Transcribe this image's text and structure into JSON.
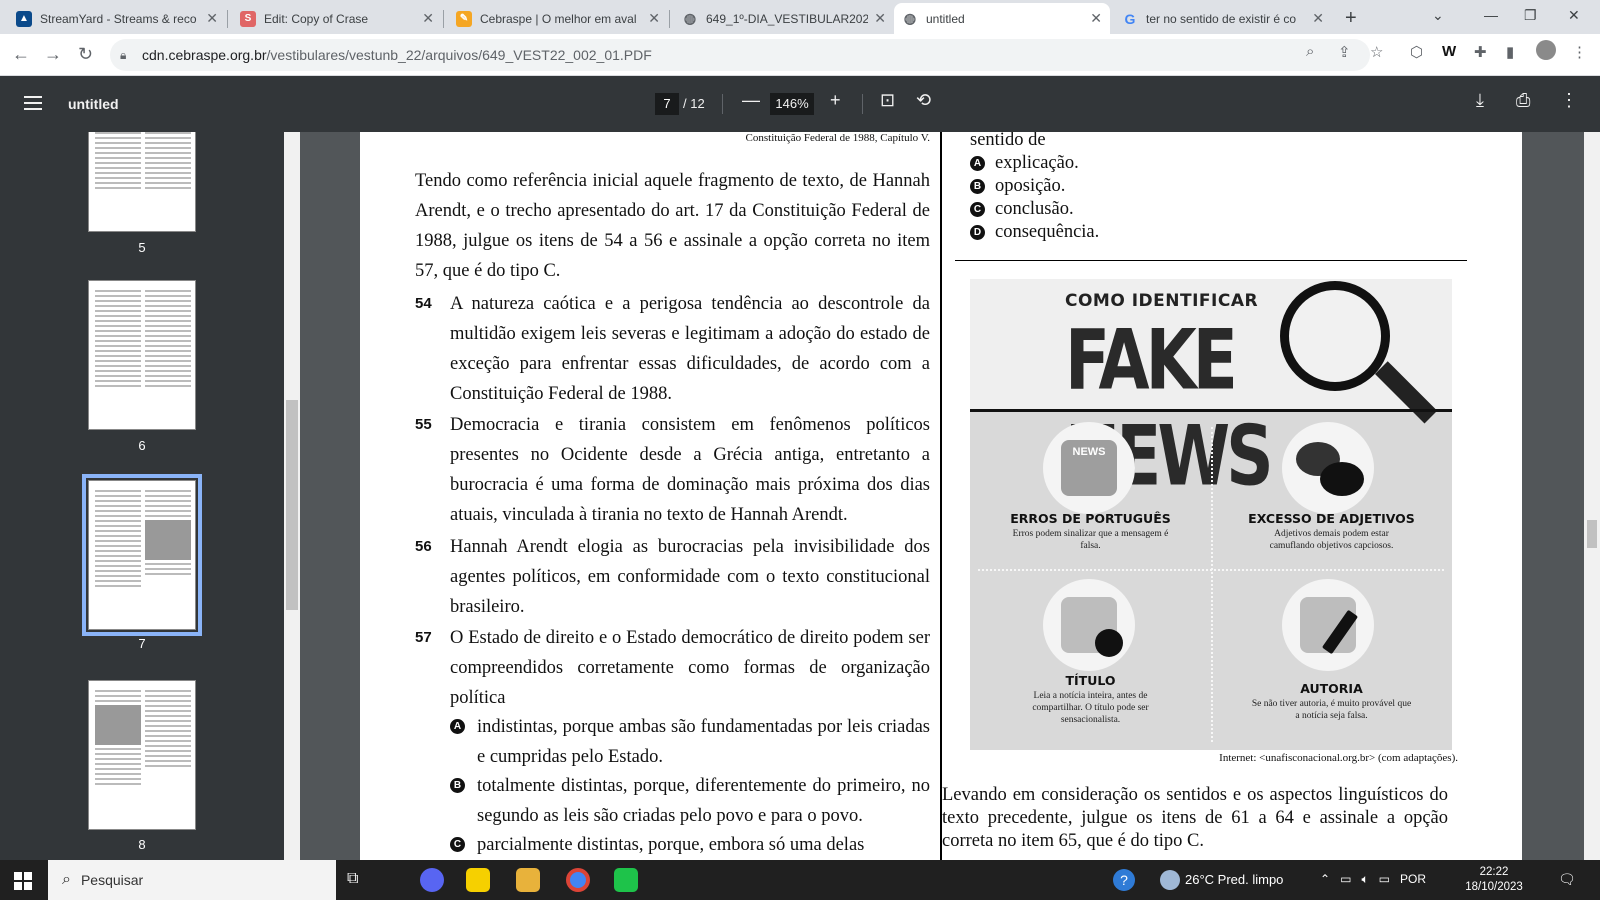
{
  "tabs": [
    {
      "title": "StreamYard - Streams & reco",
      "icon": "streamyard-icon",
      "color": "#0b4a8b"
    },
    {
      "title": "Edit: Copy of Crase",
      "icon": "s-icon",
      "color": "#e06666"
    },
    {
      "title": "Cebraspe | O melhor em aval",
      "icon": "cebraspe-icon",
      "color": "#f5a623"
    },
    {
      "title": "649_1º-DIA_VESTIBULAR202",
      "icon": "globe-icon",
      "color": "#5f6368"
    },
    {
      "title": "untitled",
      "icon": "globe-icon",
      "color": "#5f6368"
    },
    {
      "title": "ter no sentido de existir é co",
      "icon": "google-icon",
      "color": "#4285f4"
    }
  ],
  "address": {
    "host": "cdn.cebraspe.org.br",
    "path": "/vestibulares/vestunb_22/arquivos/649_VEST22_002_01.PDF"
  },
  "pdf": {
    "title": "untitled",
    "page": "7",
    "total": "/ 12",
    "zoom": "146%"
  },
  "thumbnails": [
    "5",
    "6",
    "7",
    "8"
  ],
  "document": {
    "source1": "Constituição Federal de 1988, Capítulo V.",
    "intro": "Tendo como referência inicial aquele fragmento de texto, de Hannah Arendt, e o trecho apresentado do art. 17 da Constituição Federal de 1988, julgue os itens de 54 a 56 e assinale a opção correta no item 57, que é do tipo C.",
    "items": [
      {
        "num": "54",
        "text": "A natureza caótica e a perigosa tendência ao descontrole da multidão exigem leis severas e legitimam a adoção do estado de exceção para enfrentar essas dificuldades, de acordo com a Constituição Federal de 1988."
      },
      {
        "num": "55",
        "text": "Democracia e tirania consistem em fenômenos políticos presentes no Ocidente desde a Grécia antiga, entretanto a burocracia é uma forma de dominação mais próxima dos dias atuais, vinculada à tirania no texto de Hannah Arendt."
      },
      {
        "num": "56",
        "text": "Hannah Arendt elogia as burocracias pela invisibilidade dos agentes políticos, em conformidade com o texto constitucional brasileiro."
      },
      {
        "num": "57",
        "text": "O Estado de direito e o Estado democrático de direito podem ser compreendidos corretamente como formas de organização política"
      }
    ],
    "options57": [
      {
        "letter": "A",
        "text": "indistintas, porque ambas são fundamentadas por leis criadas e cumpridas pelo Estado."
      },
      {
        "letter": "B",
        "text": "totalmente distintas, porque, diferentemente do primeiro, no segundo as leis são criadas pelo povo e para o povo."
      },
      {
        "letter": "C",
        "text": "parcialmente distintas, porque, embora só uma delas"
      }
    ],
    "right_top": "sentido de",
    "right_options": [
      {
        "letter": "A",
        "text": "explicação."
      },
      {
        "letter": "B",
        "text": "oposição."
      },
      {
        "letter": "C",
        "text": "conclusão."
      },
      {
        "letter": "D",
        "text": "consequência."
      }
    ],
    "infographic": {
      "title1": "COMO IDENTIFICAR",
      "title2": "FAKE NEWS",
      "icon_text": "NEWS",
      "cells": [
        {
          "label": "ERROS DE PORTUGUÊS",
          "text": "Erros podem sinalizar que a mensagem é falsa."
        },
        {
          "label": "EXCESSO DE ADJETIVOS",
          "text": "Adjetivos demais podem estar camuflando objetivos capciosos."
        },
        {
          "label": "TÍTULO",
          "text": "Leia a notícia inteira, antes de compartilhar. O título pode ser sensacionalista."
        },
        {
          "label": "AUTORIA",
          "text": "Se não tiver autoria, é muito provável que a notícia seja falsa."
        }
      ]
    },
    "source2": "Internet: <unafisconacional.org.br> (com adaptações).",
    "final": "Levando em consideração os sentidos e os aspectos linguísticos do texto precedente, julgue os itens de 61 a 64 e assinale a opção correta no item 65, que é do tipo C."
  },
  "taskbar": {
    "search": "Pesquisar",
    "weather": "26°C  Pred. limpo",
    "lang": "POR",
    "time": "22:22",
    "date": "18/10/2023"
  }
}
